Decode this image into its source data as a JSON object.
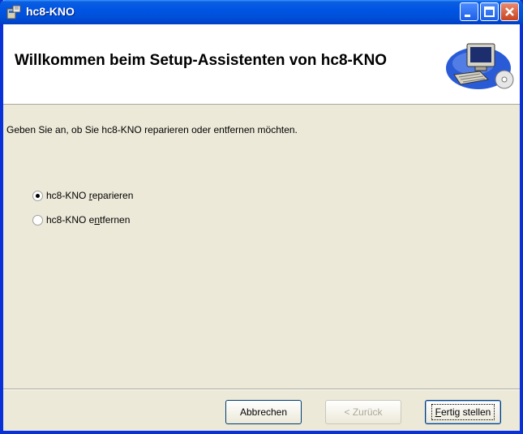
{
  "window": {
    "title": "hc8-KNO"
  },
  "header": {
    "title": "Willkommen beim Setup-Assistenten von hc8-KNO"
  },
  "main": {
    "prompt": "Geben Sie an, ob Sie hc8-KNO reparieren oder entfernen möchten.",
    "options": [
      {
        "prefix": "hc8-KNO ",
        "accel": "r",
        "suffix": "eparieren",
        "selected": true
      },
      {
        "prefix": "hc8-KNO e",
        "accel": "n",
        "suffix": "tfernen",
        "selected": false
      }
    ]
  },
  "footer": {
    "cancel_label": "Abbrechen",
    "back_label": "< Zurück",
    "finish_accel": "F",
    "finish_rest": "ertig stellen"
  }
}
